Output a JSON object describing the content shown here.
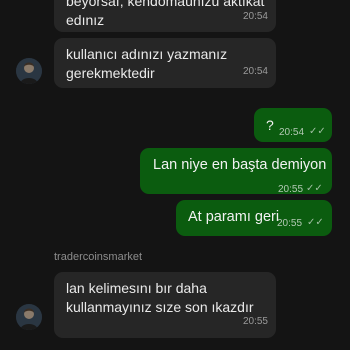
{
  "messages": [
    {
      "direction": "incoming",
      "lines": [
        "beyorsaı, kendomaunızu aktıkat",
        "edınız"
      ],
      "time": "20:54"
    },
    {
      "direction": "incoming",
      "lines": [
        "kullanıcı adınızı yazmanız",
        "gerekmektedir"
      ],
      "time": "20:54"
    },
    {
      "direction": "outgoing",
      "text": "?",
      "time": "20:54"
    },
    {
      "direction": "outgoing",
      "text": "Lan niye en başta demiyon",
      "time": "20:55"
    },
    {
      "direction": "outgoing",
      "text": "At paramı geri",
      "time": "20:55"
    },
    {
      "direction": "incoming",
      "sender": "tradercoinsmarket",
      "lines": [
        "lan kelimesını bır daha",
        "kullanmayınız sıze son ıkazdır"
      ],
      "time": "20:55"
    }
  ],
  "colors": {
    "background": "#141414",
    "incoming_bubble": "#262626",
    "outgoing_bubble": "#0b5c0f"
  },
  "icons": {
    "read_receipt": "double-check-icon",
    "avatar": "user-avatar"
  }
}
